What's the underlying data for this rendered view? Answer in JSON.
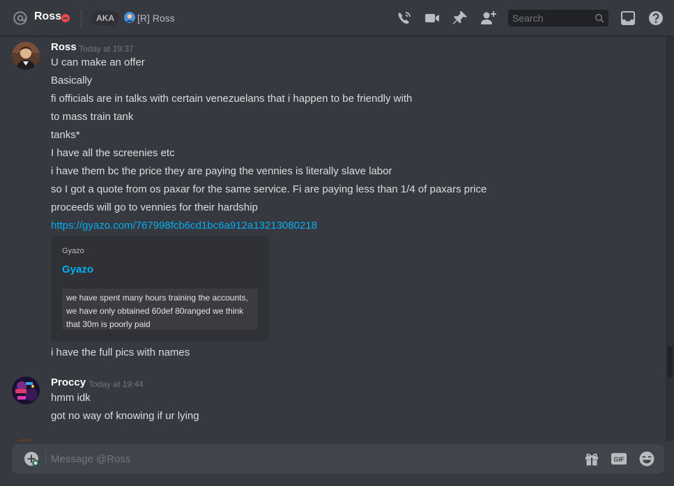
{
  "header": {
    "channel_name": "Ross",
    "status": "do-not-disturb",
    "aka_label": "AKA",
    "aka_name": "[R] Ross",
    "search_placeholder": "Search",
    "icons": [
      "at-icon",
      "dnd-status-icon",
      "voice-call-icon",
      "video-call-icon",
      "pin-icon",
      "add-friend-icon",
      "search-icon",
      "inbox-icon",
      "help-icon"
    ]
  },
  "messages": [
    {
      "author": "Ross",
      "timestamp": "Today at 19:37",
      "lines": [
        "U can make an offer",
        "Basically",
        "fi officials are in talks with certain venezuelans that i happen to be friendly with",
        "to mass train tank",
        "tanks*",
        "I have all the screenies etc",
        "i have them bc the price they are paying the vennies is literally slave labor",
        "so I got a quote from os paxar for the same service. Fi are paying less than 1/4 of paxars price",
        "proceeds will go to vennies for their hardship"
      ],
      "link": "https://gyazo.com/767998fcb6cd1bc6a912a13213080218",
      "embed": {
        "provider": "Gyazo",
        "title": "Gyazo",
        "image_text": [
          "we have spent many hours training the accounts,",
          "we have only obtained 60def 80ranged we think",
          "that 30m is poorly paid"
        ]
      },
      "after_embed": "i have the full pics with names"
    },
    {
      "author": "Proccy",
      "timestamp": "Today at 19:44",
      "lines": [
        "hmm idk",
        "got no way of knowing if ur lying"
      ]
    }
  ],
  "composer": {
    "placeholder": "Message @Ross",
    "icons": [
      "attach-plus-icon",
      "gift-icon",
      "gif-icon",
      "emoji-icon"
    ],
    "gif_label": "GIF"
  },
  "colors": {
    "background": "#36393f",
    "header_text": "#ffffff",
    "body_text": "#dcddde",
    "muted": "#72767d",
    "link": "#00b0f4",
    "dnd": "#f04747",
    "embed_bg": "#2f3136",
    "composer_bg": "#40444b"
  }
}
